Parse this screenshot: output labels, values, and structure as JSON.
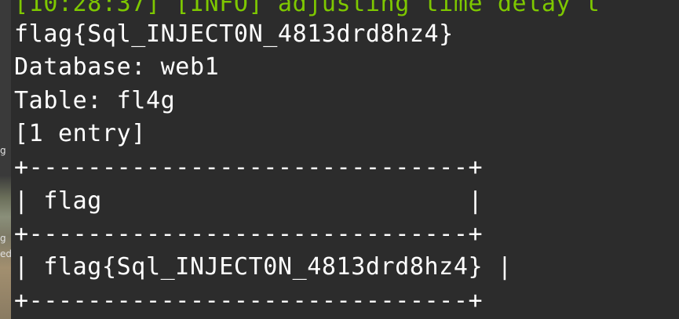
{
  "terminal": {
    "log_line": "[10:28:37] [INFO] adjusting time delay t",
    "flag_line": "flag{Sql_INJECT0N_4813drd8hz4}",
    "database_line": "Database: web1",
    "table_line": "Table: fl4g",
    "entry_count_line": "[1 entry]",
    "table_border_top": "+------------------------------+",
    "table_header_row": "| flag                         |",
    "table_border_mid": "+------------------------------+",
    "table_data_row": "| flag{Sql_INJECT0N_4813drd8hz4} |",
    "table_border_bottom": "+------------------------------+"
  },
  "desktop": {
    "fragment_1": "g",
    "fragment_2": "g",
    "fragment_3": "ed"
  },
  "colors": {
    "terminal_background": "#2c2c2c",
    "text": "#ffffff",
    "log_text": "#7ec800"
  }
}
